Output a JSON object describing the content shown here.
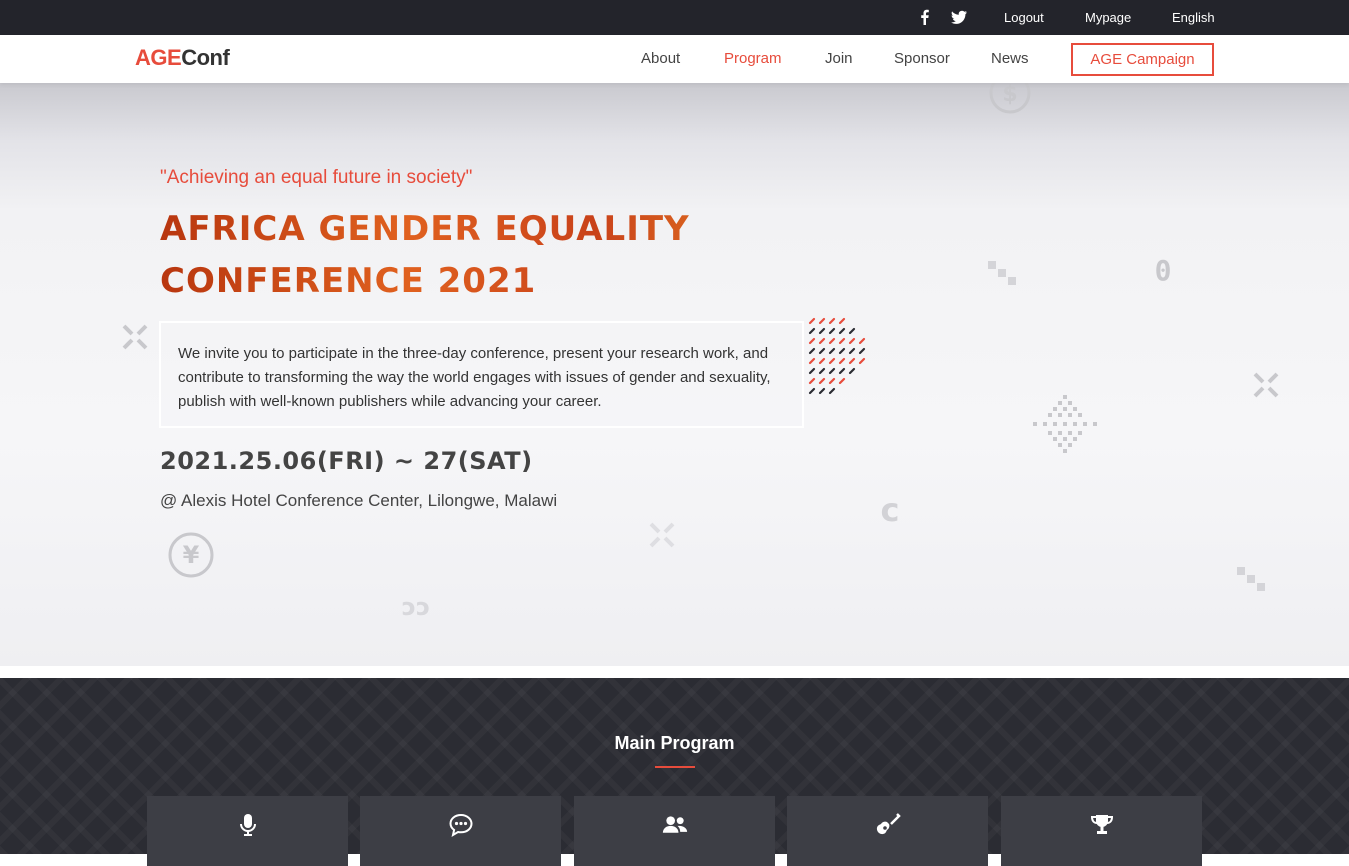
{
  "topbar": {
    "social": [
      {
        "name": "facebook-icon"
      },
      {
        "name": "twitter-icon"
      }
    ],
    "links": [
      "Logout",
      "Mypage",
      "English"
    ]
  },
  "nav": {
    "logo": {
      "age": "AGE",
      "conf": "Conf"
    },
    "items": [
      "About",
      "Program",
      "Join",
      "Sponsor",
      "News"
    ],
    "active_item": "Program",
    "campaign": "AGE Campaign"
  },
  "hero": {
    "tagline": "\"Achieving an equal future in society\"",
    "title_line1": "Africa Gender Equality",
    "title_line2": "Conference 2021",
    "description": "We invite you to participate in the three-day conference, present your research work, and contribute to transforming the way the world engages with issues of gender and sexuality, publish with well-known publishers while advancing your career.",
    "date": "2021.25.06(FRI) ~ 27(SAT)",
    "venue": "@ Alexis Hotel Conference Center, Lilongwe, Malawi"
  },
  "program": {
    "title": "Main Program",
    "cards": [
      {
        "icon": "microphone-icon"
      },
      {
        "icon": "chat-bubble-icon"
      },
      {
        "icon": "users-icon"
      },
      {
        "icon": "guitar-icon"
      },
      {
        "icon": "trophy-icon"
      }
    ]
  },
  "colors": {
    "accent": "#e74c3c",
    "topbar_bg": "#23242b",
    "program_bg": "#2b2c33",
    "card_bg": "#3d3e45",
    "title_orange": "#d7561d"
  }
}
